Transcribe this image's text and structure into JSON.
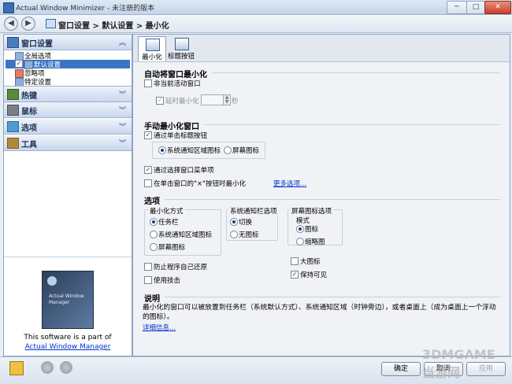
{
  "window": {
    "title": "Actual Window Minimizer - 未注册的版本",
    "buttons": {
      "minimize": "─",
      "maximize": "□",
      "close": "✕"
    }
  },
  "navbar": {
    "back_icon": "back-arrow-icon",
    "forward_icon": "forward-arrow-icon",
    "breadcrumb": "窗口设置 > 默认设置 > 最小化"
  },
  "sidebar": {
    "sections": [
      {
        "label": "窗口设置",
        "chevron": "︽",
        "icon": "window-settings-icon"
      },
      {
        "label": "热键",
        "chevron": "︾",
        "icon": "hotkey-icon"
      },
      {
        "label": "鼠标",
        "chevron": "︾",
        "icon": "mouse-icon"
      },
      {
        "label": "选项",
        "chevron": "︾",
        "icon": "options-icon"
      },
      {
        "label": "工具",
        "chevron": "︾",
        "icon": "tools-icon"
      }
    ],
    "tree_items": [
      {
        "label": "全局选项",
        "checked": false,
        "selected": false
      },
      {
        "label": "默认设置",
        "checked": true,
        "selected": true
      },
      {
        "label": "忽略项",
        "checked": false,
        "selected": false
      },
      {
        "label": "特定设置",
        "checked": false,
        "selected": false
      }
    ],
    "promo": {
      "image_caption": "Actual Window Manager",
      "text": "This software is a part of",
      "link": "Actual Window Manager"
    }
  },
  "tabs": [
    {
      "label": "最小化",
      "active": true
    },
    {
      "label": "标题按钮",
      "active": false
    }
  ],
  "auto_minimize": {
    "title": "自动将窗口最小化",
    "non_active_label": "非当前活动窗口",
    "non_active_checked": false,
    "delay_label": "延时最小化",
    "delay_value": "1",
    "delay_unit": "秒"
  },
  "manual_minimize": {
    "title": "手动最小化窗口",
    "click_title_label": "通过单击标题按钮",
    "click_title_checked": true,
    "radio_tray": "系统通知区域图标",
    "radio_screen": "屏幕图标",
    "selected_radio": "tray",
    "menu_label": "通过选择窗口菜单项",
    "menu_checked": true,
    "close_btn_label": "在单击窗口的\"×\"按钮时最小化",
    "close_btn_checked": false,
    "more_link": "更多选项..."
  },
  "options": {
    "title": "选项",
    "minimize_mode": {
      "title": "最小化方式",
      "items": [
        "任务栏",
        "系统通知区域图标",
        "屏幕图标"
      ],
      "selected": 0
    },
    "tray_options": {
      "title": "系统通知栏选项",
      "items": [
        "切换",
        "无图标"
      ],
      "selected": 0
    },
    "screen_options": {
      "title": "屏幕图标选项",
      "mode_title": "模式",
      "items": [
        "图标",
        "缩略图"
      ],
      "selected": 0,
      "large_icon_label": "大图标",
      "large_icon_checked": false,
      "keep_visible_label": "保持可见",
      "keep_visible_checked": true
    },
    "prevent_restore_label": "防止程序自己还原",
    "prevent_restore_checked": false,
    "use_trick_label": "使用技击",
    "use_trick_checked": false
  },
  "description": {
    "title": "说明",
    "text": "最小化的窗口可以被放置到任务栏（系统默认方式）、系统通知区域（时钟旁边），或者桌面上（成为桌面上一个浮动的图标）。",
    "link": "详细信息..."
  },
  "bottom": {
    "help_icon": "help-icon",
    "undo_icon": "undo-icon",
    "redo_icon": "redo-icon",
    "ok": "确定",
    "cancel": "取消",
    "apply": "应用"
  },
  "watermark": "3DMGAME 当游网"
}
